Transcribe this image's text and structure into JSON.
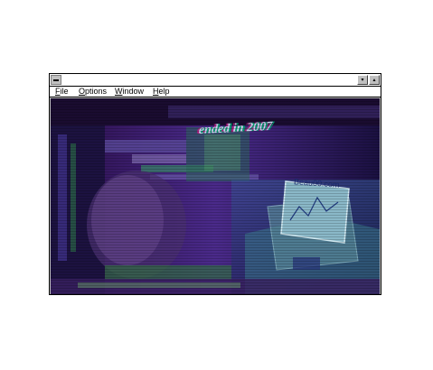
{
  "window": {
    "title": "",
    "minimize_glyph": "▾",
    "maximize_glyph": "▴"
  },
  "menubar": {
    "items": [
      {
        "label_hot": "F",
        "label_rest": "ile"
      },
      {
        "label_hot": "O",
        "label_rest": "ptions"
      },
      {
        "label_hot": "W",
        "label_rest": "indow"
      },
      {
        "label_hot": "H",
        "label_rest": "elp"
      }
    ]
  },
  "content": {
    "overlay_text": "ended in 2007",
    "screen_text": "Beau00.com"
  },
  "colors": {
    "background": "#120a26",
    "glitch_purple": "#5a2a9a",
    "glitch_green": "#2f8a4a",
    "glitch_teal": "#3a8a8a"
  },
  "icons": [
    "system-menu-icon",
    "minimize-arrow-icon",
    "maximize-arrow-icon"
  ]
}
